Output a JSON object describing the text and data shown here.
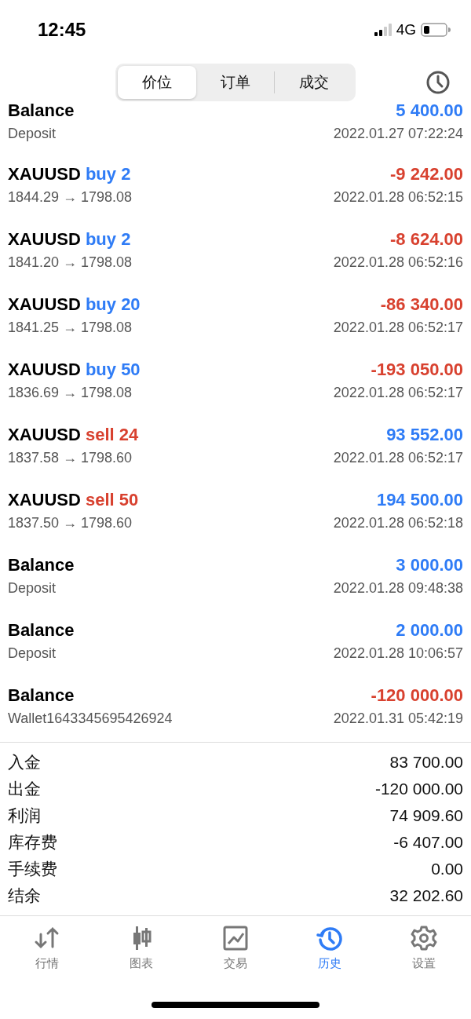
{
  "status_bar": {
    "time": "12:45",
    "network": "4G"
  },
  "tabs": [
    {
      "label": "价位",
      "selected": true
    },
    {
      "label": "订单",
      "selected": false
    },
    {
      "label": "成交",
      "selected": false
    }
  ],
  "deals": [
    {
      "symbol": "Balance",
      "detail": "Deposit",
      "amount": "5 400.00",
      "loss": false,
      "time": "2022.01.27 07:22:24"
    },
    {
      "symbol": "XAUUSD",
      "kind": "buy",
      "action": "buy 2",
      "detail": "1844.29 → 1798.08",
      "amount": "-9 242.00",
      "loss": true,
      "time": "2022.01.28 06:52:15"
    },
    {
      "symbol": "XAUUSD",
      "kind": "buy",
      "action": "buy 2",
      "detail": "1841.20 → 1798.08",
      "amount": "-8 624.00",
      "loss": true,
      "time": "2022.01.28 06:52:16"
    },
    {
      "symbol": "XAUUSD",
      "kind": "buy",
      "action": "buy 20",
      "detail": "1841.25 → 1798.08",
      "amount": "-86 340.00",
      "loss": true,
      "time": "2022.01.28 06:52:17"
    },
    {
      "symbol": "XAUUSD",
      "kind": "buy",
      "action": "buy 50",
      "detail": "1836.69 → 1798.08",
      "amount": "-193 050.00",
      "loss": true,
      "time": "2022.01.28 06:52:17"
    },
    {
      "symbol": "XAUUSD",
      "kind": "sell",
      "action": "sell 24",
      "detail": "1837.58 → 1798.60",
      "amount": "93 552.00",
      "loss": false,
      "time": "2022.01.28 06:52:17"
    },
    {
      "symbol": "XAUUSD",
      "kind": "sell",
      "action": "sell 50",
      "detail": "1837.50 → 1798.60",
      "amount": "194 500.00",
      "loss": false,
      "time": "2022.01.28 06:52:18"
    },
    {
      "symbol": "Balance",
      "detail": "Deposit",
      "amount": "3 000.00",
      "loss": false,
      "time": "2022.01.28 09:48:38"
    },
    {
      "symbol": "Balance",
      "detail": "Deposit",
      "amount": "2 000.00",
      "loss": false,
      "time": "2022.01.28 10:06:57"
    },
    {
      "symbol": "Balance",
      "detail": "Wallet1643345695426924",
      "amount": "-120 000.00",
      "loss": true,
      "time": "2022.01.31 05:42:19"
    }
  ],
  "summary": [
    {
      "label": "入金",
      "value": "83 700.00"
    },
    {
      "label": "出金",
      "value": "-120 000.00"
    },
    {
      "label": "利润",
      "value": "74 909.60"
    },
    {
      "label": "库存费",
      "value": "-6 407.00"
    },
    {
      "label": "手续费",
      "value": "0.00"
    },
    {
      "label": "结余",
      "value": "32 202.60"
    }
  ],
  "nav": [
    {
      "kind": "quotes",
      "label": "行情",
      "selected": false
    },
    {
      "kind": "chart",
      "label": "图表",
      "selected": false
    },
    {
      "kind": "trade",
      "label": "交易",
      "selected": false
    },
    {
      "kind": "history",
      "label": "历史",
      "selected": true
    },
    {
      "kind": "settings",
      "label": "设置",
      "selected": false
    }
  ]
}
